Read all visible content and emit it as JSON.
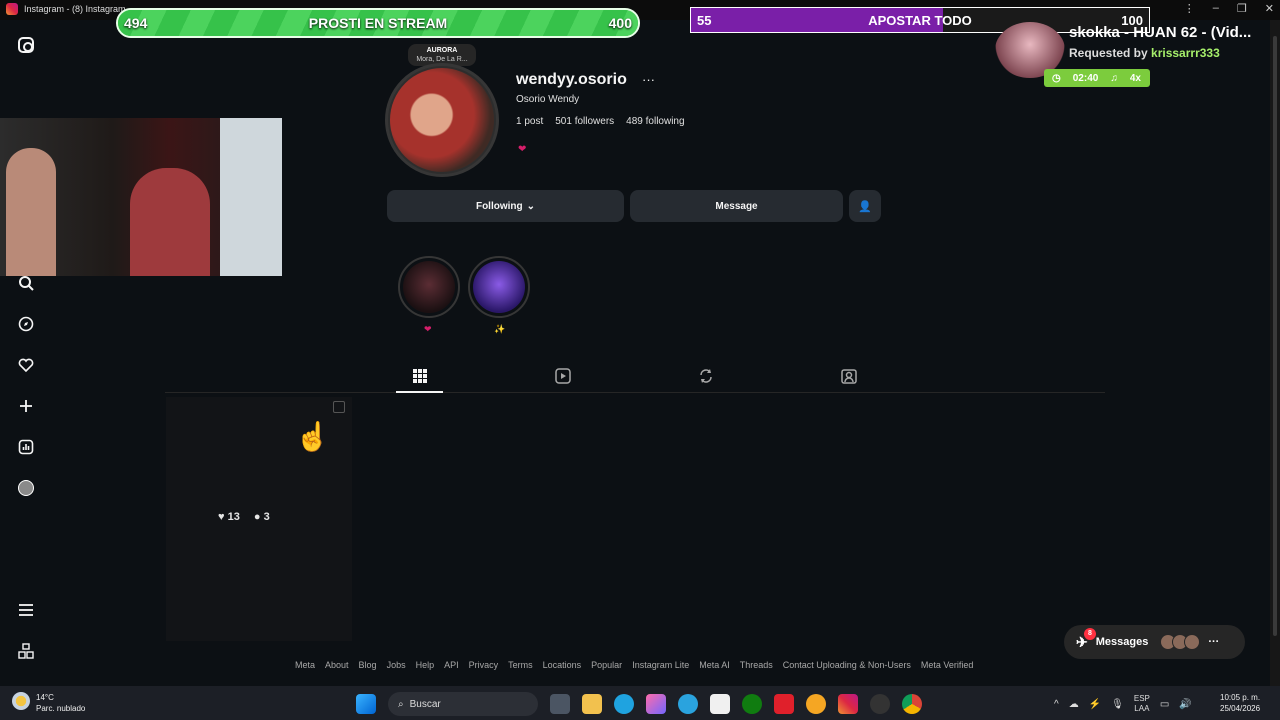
{
  "window": {
    "title": "Instagram - (8) Instagram"
  },
  "overlay": {
    "vote_left": {
      "left_count": "494",
      "title": "PROSTI EN STREAM",
      "right_count": "400"
    },
    "vote_right": {
      "left_count": "55",
      "title": "APOSTAR TODO",
      "right_count": "100",
      "fill_percent": 55
    },
    "now_playing": {
      "title": "skokka - HUAN 62 - (Vid...",
      "requested_by_label": "Requested by",
      "requested_by_user": "krissarrr333",
      "time": "02:40",
      "speed": "4x"
    }
  },
  "profile": {
    "note": {
      "title": "AURORA",
      "subtitle": "Mora, De La R..."
    },
    "username": "wendyy.osorio",
    "full_name": "Osorio Wendy",
    "posts": "1 post",
    "followers": "501 followers",
    "following": "489 following",
    "bio": "❤",
    "following_button": "Following",
    "message_button": "Message",
    "highlights": [
      {
        "label": "❤"
      },
      {
        "label": "✨"
      }
    ]
  },
  "post": {
    "likes": "13",
    "comments": "3"
  },
  "footer_links": [
    "Meta",
    "About",
    "Blog",
    "Jobs",
    "Help",
    "API",
    "Privacy",
    "Terms",
    "Locations",
    "Popular",
    "Instagram Lite",
    "Meta AI",
    "Threads",
    "Contact Uploading & Non-Users",
    "Meta Verified"
  ],
  "messages": {
    "label": "Messages",
    "count": "8"
  },
  "taskbar": {
    "weather_temp": "14°C",
    "weather_desc": "Parc. nublado",
    "search_placeholder": "Buscar",
    "lang_1": "ESP",
    "lang_2": "LAA",
    "time": "10:05 p. m.",
    "date": "25/04/2026"
  },
  "colors": {
    "accent_green": "#36c24a",
    "accent_purple": "#7a1fa8",
    "bg": "#0c1014",
    "notification": "#ff3040"
  }
}
